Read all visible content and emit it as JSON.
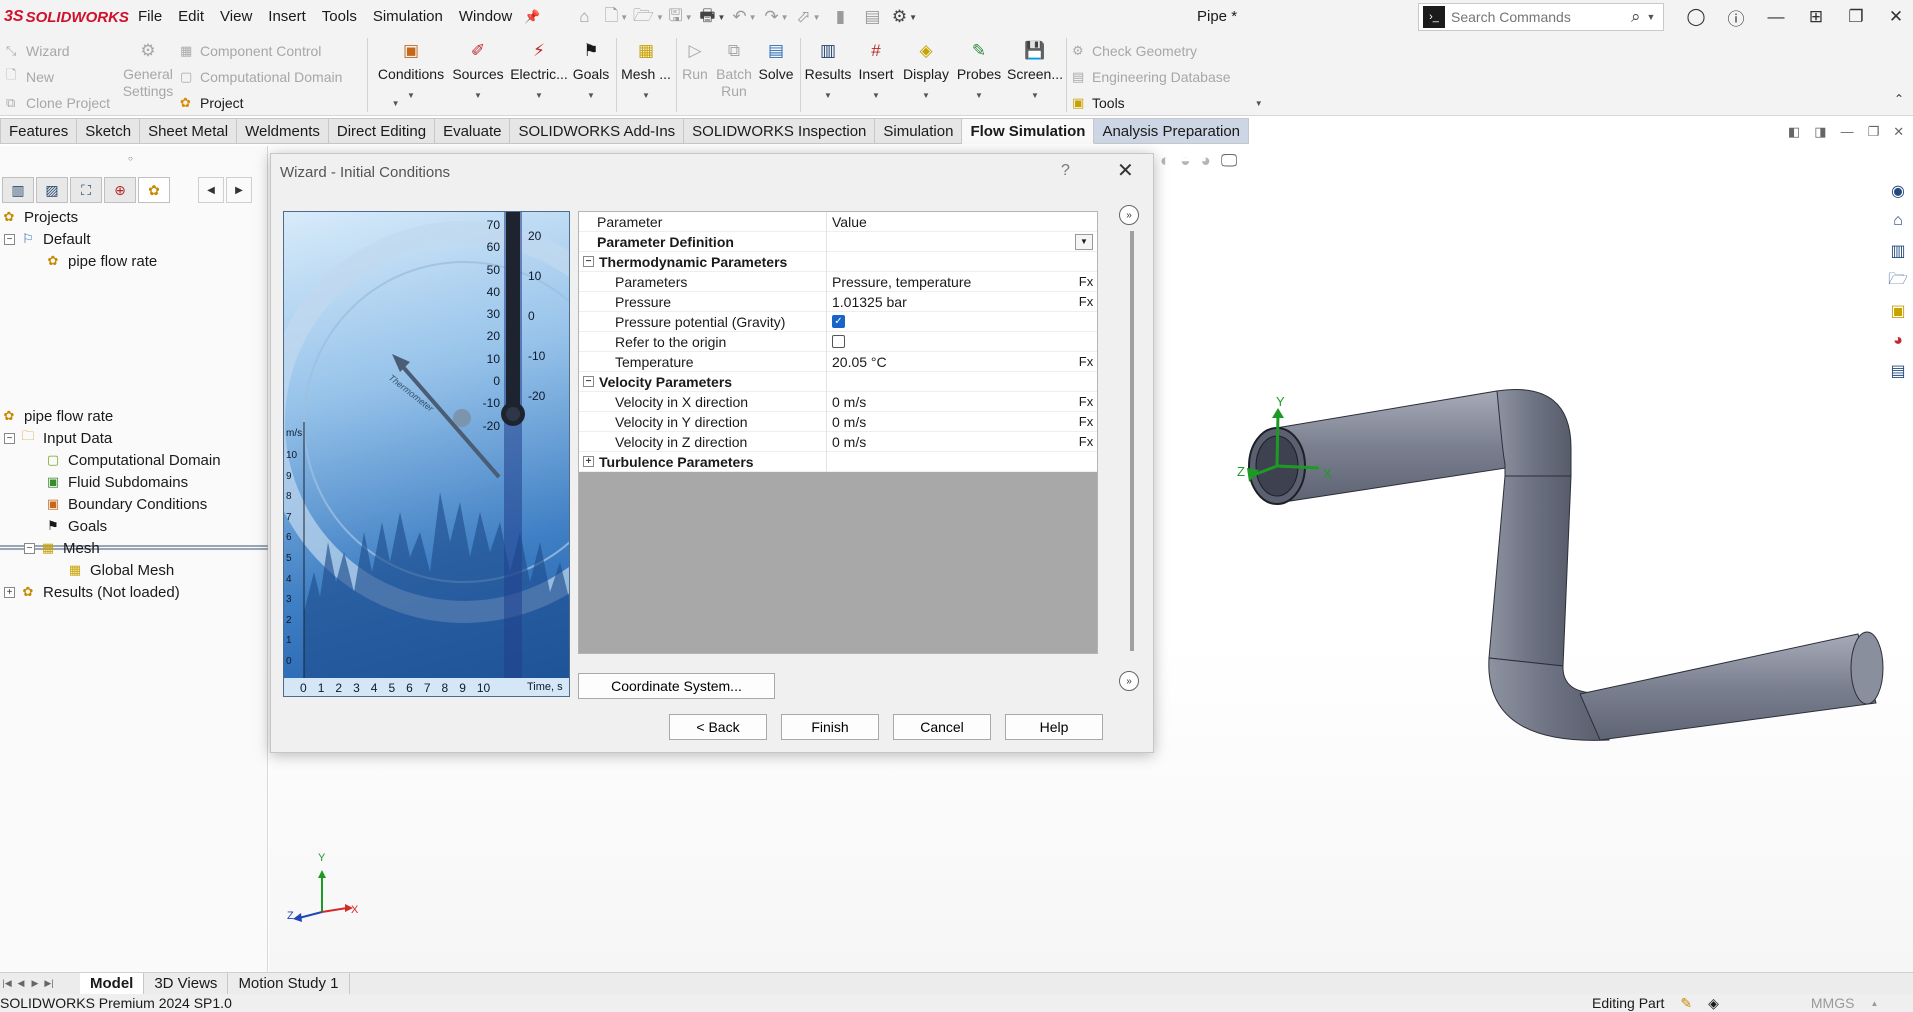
{
  "app": {
    "logo": "SOLIDWORKS",
    "document_title": "Pipe *",
    "menu": [
      "File",
      "Edit",
      "View",
      "Insert",
      "Tools",
      "Simulation",
      "Window"
    ]
  },
  "search": {
    "placeholder": "Search Commands"
  },
  "ribbon": {
    "left_group": [
      "Wizard",
      "New",
      "Clone Project"
    ],
    "general_settings": "General Settings",
    "comp_group": [
      "Component Control",
      "Computational Domain"
    ],
    "project": "Project",
    "buttons": [
      "Conditions",
      "Sources",
      "Electric...",
      "Goals",
      "Mesh ...",
      "Run",
      "Batch Run",
      "Solve",
      "Results",
      "Insert",
      "Display",
      "Probes",
      "Screen..."
    ],
    "right_group": [
      "Check Geometry",
      "Engineering Database"
    ],
    "tools": "Tools"
  },
  "tabs": [
    "Features",
    "Sketch",
    "Sheet Metal",
    "Weldments",
    "Direct Editing",
    "Evaluate",
    "SOLIDWORKS Add-Ins",
    "SOLIDWORKS Inspection",
    "Simulation",
    "Flow Simulation",
    "Analysis Preparation"
  ],
  "active_tab": "Flow Simulation",
  "projects_tree": {
    "root": "Projects",
    "default": "Default",
    "project": "pipe flow rate"
  },
  "analysis_tree": {
    "root": "pipe flow rate",
    "input_data": "Input Data",
    "items": [
      "Computational Domain",
      "Fluid Subdomains",
      "Boundary Conditions",
      "Goals",
      "Mesh"
    ],
    "global_mesh": "Global Mesh",
    "results": "Results (Not loaded)"
  },
  "dialog": {
    "title": "Wizard - Initial Conditions",
    "help_glyph": "?",
    "header": {
      "parameter": "Parameter",
      "value": "Value"
    },
    "param_definition": "Parameter Definition",
    "thermo_section": "Thermodynamic Parameters",
    "rows": [
      {
        "name": "Parameters",
        "value": "Pressure, temperature",
        "fx": "Fx"
      },
      {
        "name": "Pressure",
        "value": "1.01325 bar",
        "fx": "Fx"
      },
      {
        "name": "Pressure potential (Gravity)",
        "checked": true
      },
      {
        "name": "Refer to the origin",
        "checked": false
      },
      {
        "name": "Temperature",
        "value": "20.05 °C",
        "fx": "Fx"
      }
    ],
    "velocity_section": "Velocity Parameters",
    "velocity_rows": [
      {
        "name": "Velocity in X direction",
        "value": "0 m/s",
        "fx": "Fx"
      },
      {
        "name": "Velocity in Y direction",
        "value": "0 m/s",
        "fx": "Fx"
      },
      {
        "name": "Velocity in Z direction",
        "value": "0 m/s",
        "fx": "Fx"
      }
    ],
    "turbulence_section": "Turbulence Parameters",
    "coord_button": "Coordinate System...",
    "back": "< Back",
    "finish": "Finish",
    "cancel": "Cancel",
    "help": "Help"
  },
  "wizard_image": {
    "thermo_left": [
      "70",
      "60",
      "50",
      "40",
      "30",
      "20",
      "10",
      "0",
      "-10",
      "-20"
    ],
    "thermo_right": [
      "20",
      "10",
      "0",
      "-10",
      "-20"
    ],
    "yaxis_unit": "m/s",
    "yaxis": [
      "10",
      "9",
      "8",
      "7",
      "6",
      "5",
      "4",
      "3",
      "2",
      "1",
      "0"
    ],
    "xaxis": [
      "0",
      "1",
      "2",
      "3",
      "4",
      "5",
      "6",
      "7",
      "8",
      "9",
      "10"
    ],
    "xaxis_label": "Time, s",
    "gauge_text": "Thermometer"
  },
  "triad": {
    "x": "X",
    "y": "Y",
    "z": "Z"
  },
  "bottom_tabs": [
    "Model",
    "3D Views",
    "Motion Study 1"
  ],
  "status": {
    "left": "SOLIDWORKS Premium 2024 SP1.0",
    "editing": "Editing Part",
    "units": "MMGS"
  },
  "colors": {
    "accent": "#1a64c8",
    "brand": "#d0102a",
    "pipe": "#7a7f8e"
  }
}
